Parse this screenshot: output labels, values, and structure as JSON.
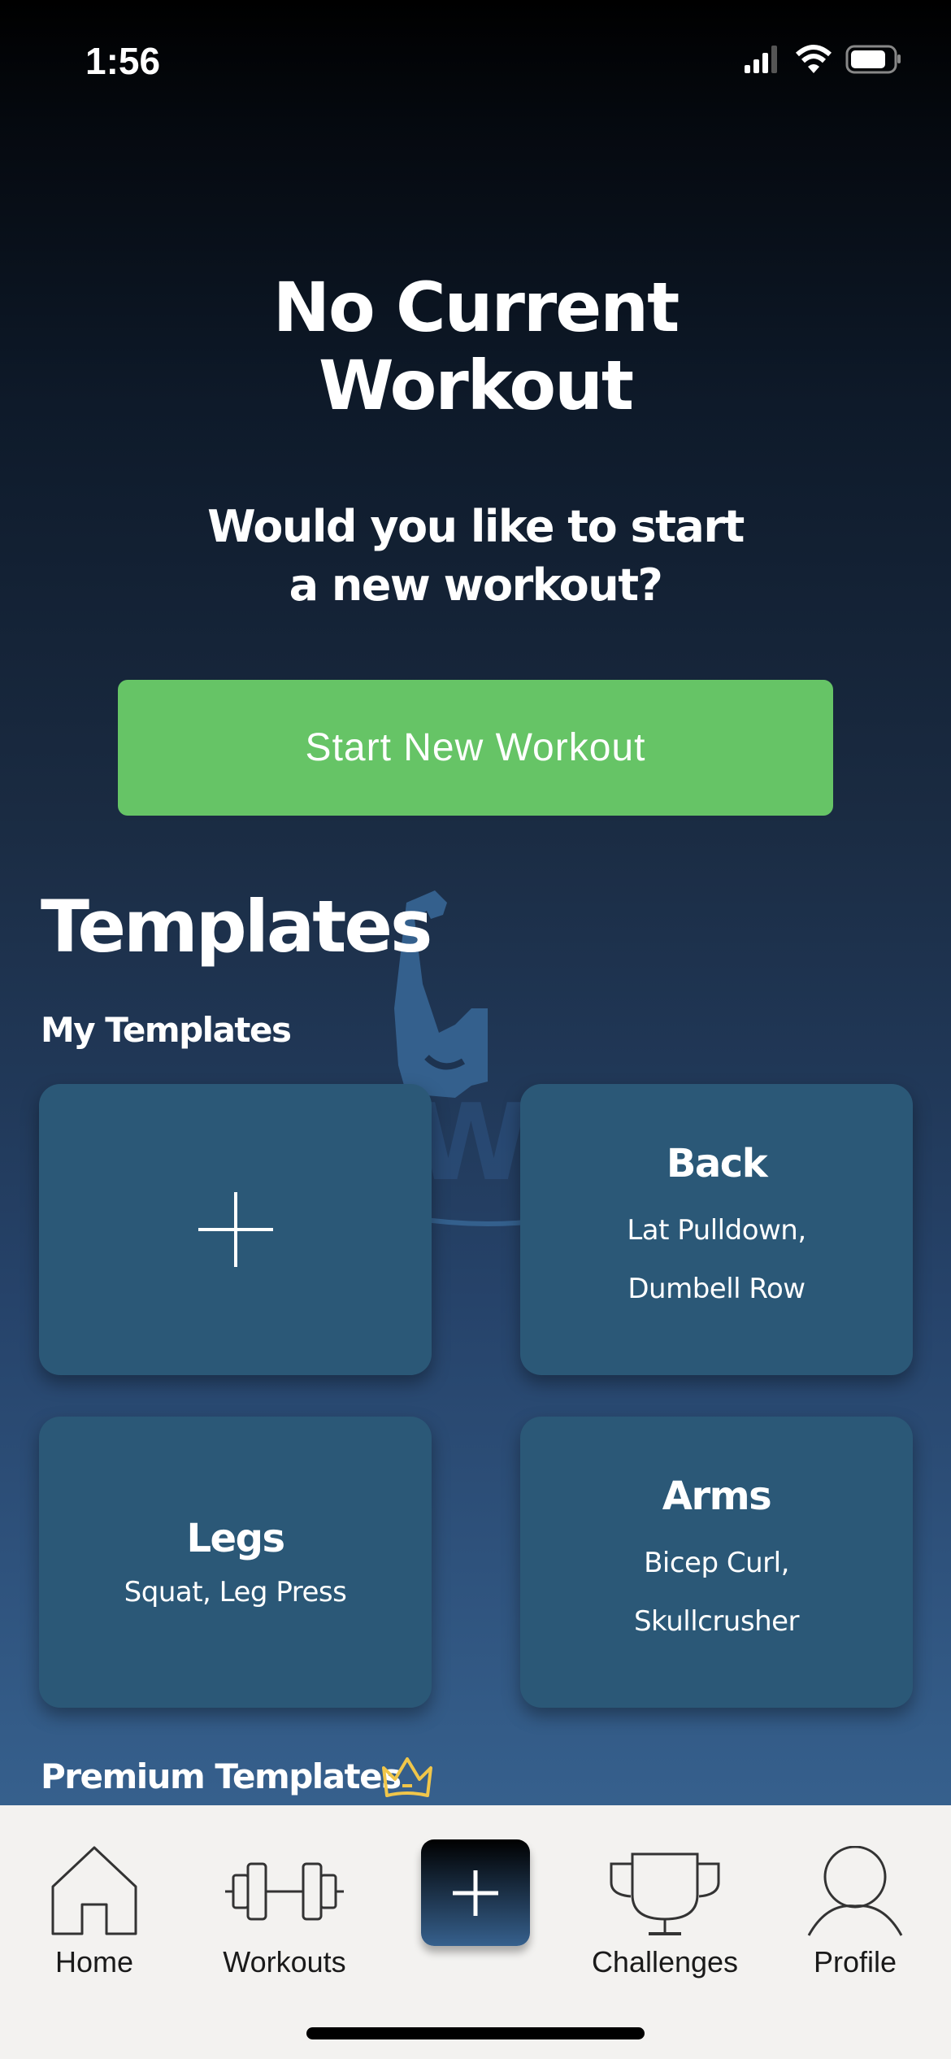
{
  "status_bar": {
    "time": "1:56"
  },
  "watermark": {
    "text": "TrainWise AI"
  },
  "empty_state": {
    "title": "No Current Workout",
    "subtitle": "Would you like to start a new workout?",
    "start_button": "Start New Workout"
  },
  "templates": {
    "heading": "Templates",
    "my_templates_label": "My Templates",
    "cards": [
      {
        "title": "Back",
        "items": [
          "Lat Pulldown,",
          "Dumbell Row"
        ]
      },
      {
        "title": "Legs",
        "items": [
          "Squat, Leg Press"
        ]
      },
      {
        "title": "Arms",
        "items": [
          "Bicep Curl,",
          "Skullcrusher"
        ]
      }
    ],
    "premium_label": "Premium Templates"
  },
  "nav": {
    "home": "Home",
    "workouts": "Workouts",
    "challenges": "Challenges",
    "profile": "Profile"
  },
  "colors": {
    "accent_green": "#66c466",
    "card": "#2b5877",
    "crown": "#f0c64a",
    "nav_bg": "#f3f2f0"
  }
}
